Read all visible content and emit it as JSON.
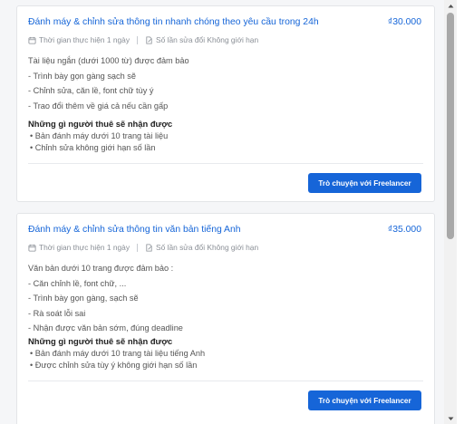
{
  "accent_color": "#1665d8",
  "listings": [
    {
      "title": "Đánh máy & chỉnh sửa thông tin nhanh chóng theo yêu cầu trong 24h",
      "price": "₫30.000",
      "duration": "Thời gian thực hiện 1 ngày",
      "revisions": "Số lần sửa đổi Không giới hạn",
      "description": [
        "Tài liệu ngắn (dưới 1000 từ) được đảm bảo",
        "- Trình bày gọn gàng sạch sẽ",
        "- Chỉnh sửa, căn lề, font chữ tùy ý",
        "- Trao đổi thêm về giá cả nếu cần gấp"
      ],
      "benefits_title": "Những gì người thuê sẽ nhận được",
      "benefits": [
        "• Bản đánh máy dưới 10 trang tài liệu",
        "• Chỉnh sửa không giới hạn số lần"
      ],
      "button_label": "Trò chuyện với Freelancer"
    },
    {
      "title": "Đánh máy & chỉnh sửa thông tin văn bản tiếng Anh",
      "price": "₫35.000",
      "duration": "Thời gian thực hiện 1 ngày",
      "revisions": "Số lần sửa đổi Không giới hạn",
      "description": [
        "Văn bản dưới 10 trang được đảm bảo :",
        "- Căn chỉnh lề, font chữ, ...",
        "- Trình bày gọn gàng, sạch sẽ",
        "- Rà soát lỗi sai",
        "- Nhận được văn bản sớm, đúng deadline"
      ],
      "benefits_title": "Những gì người thuê sẽ nhận được",
      "benefits": [
        "• Bản đánh máy dưới 10 trang tài liệu tiếng Anh",
        "• Được chỉnh sửa tùy ý không giới hạn số lần"
      ],
      "button_label": "Trò chuyện với Freelancer"
    }
  ]
}
